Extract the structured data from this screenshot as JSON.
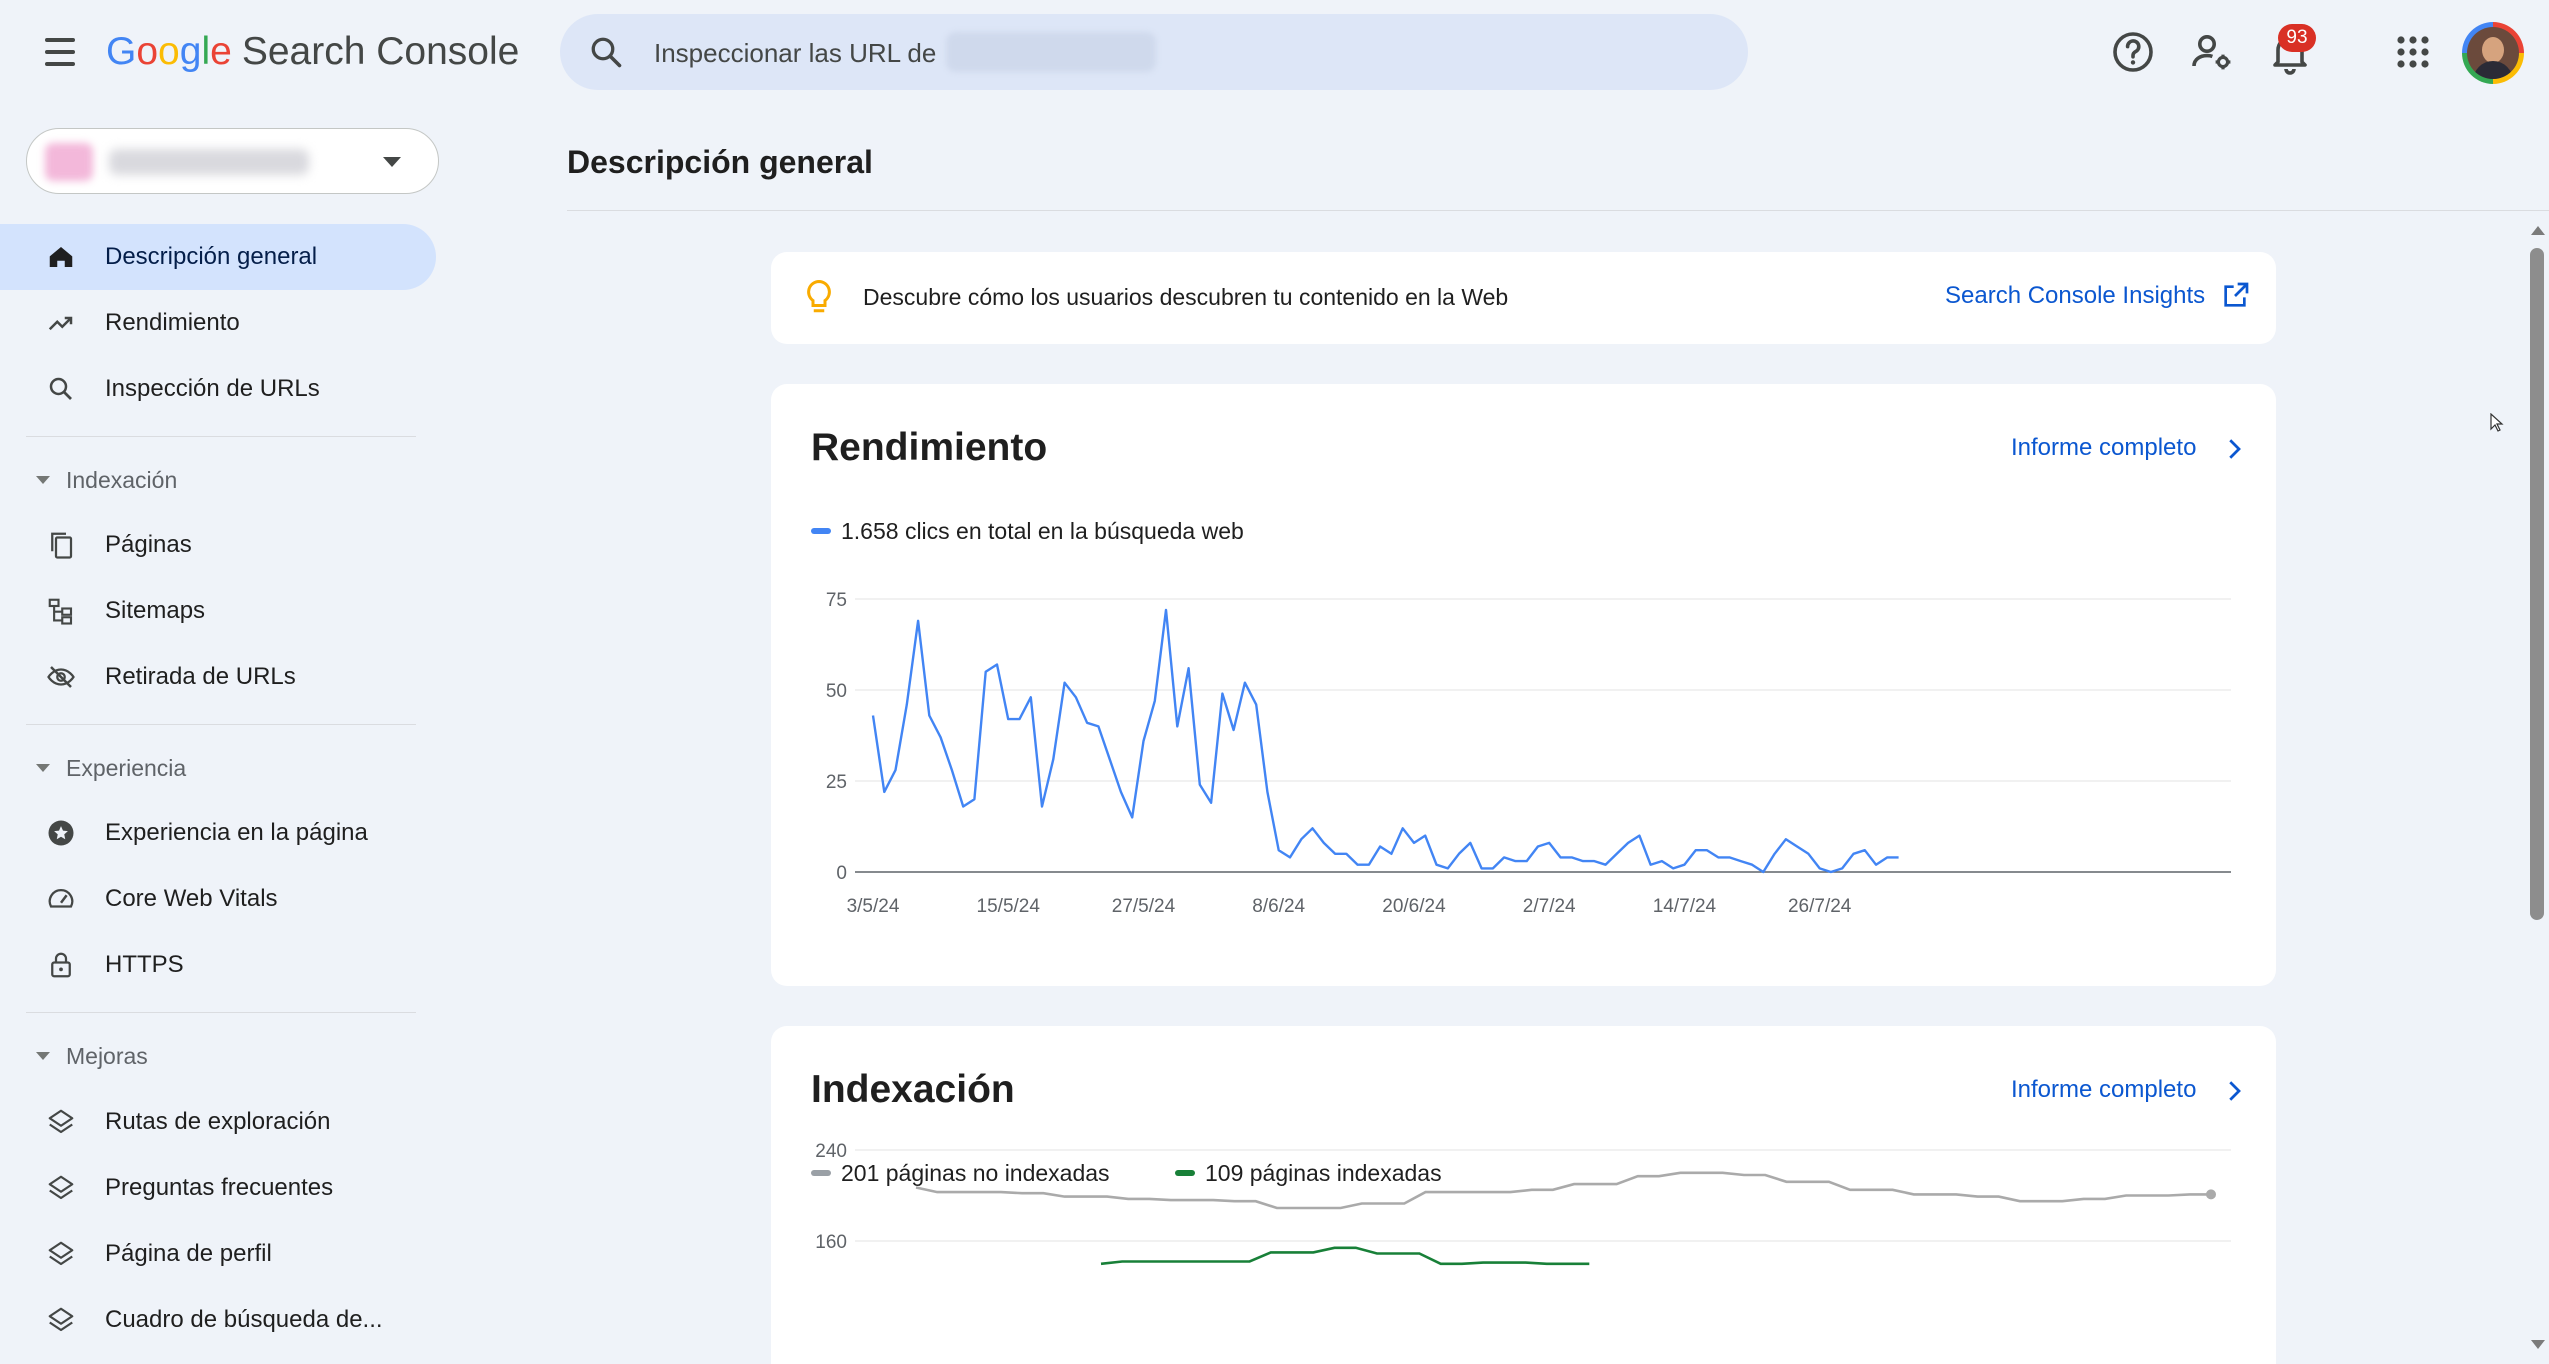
{
  "app": {
    "logo_google": [
      "G",
      "o",
      "o",
      "g",
      "l",
      "e"
    ],
    "product_name": "Search Console",
    "search_placeholder": "Inspeccionar las URL de",
    "notifications_count": "93",
    "colors": {
      "brand_blue": "#0b57d0",
      "active_nav": "#d3e3fd",
      "clicks_line": "#4285f4",
      "not_indexed_line": "#aaaaaa",
      "indexed_line": "#188038",
      "badge": "#d93025"
    }
  },
  "icons": {
    "menu": "hamburger-icon",
    "search": "search-icon",
    "help": "help-icon",
    "admin": "manage-accounts-icon",
    "notifications": "bell-icon",
    "apps": "apps-grid-icon"
  },
  "sidebar": {
    "items": [
      {
        "label": "Descripción general",
        "icon": "home-icon",
        "active": true
      },
      {
        "label": "Rendimiento",
        "icon": "trending-up-icon"
      },
      {
        "label": "Inspección de URLs",
        "icon": "search-icon"
      }
    ],
    "sections": [
      {
        "label": "Indexación",
        "items": [
          {
            "label": "Páginas",
            "icon": "pages-icon"
          },
          {
            "label": "Sitemaps",
            "icon": "sitemap-icon"
          },
          {
            "label": "Retirada de URLs",
            "icon": "eye-off-icon"
          }
        ]
      },
      {
        "label": "Experiencia",
        "items": [
          {
            "label": "Experiencia en la página",
            "icon": "star-badge-icon"
          },
          {
            "label": "Core Web Vitals",
            "icon": "speed-icon"
          },
          {
            "label": "HTTPS",
            "icon": "lock-icon"
          }
        ]
      },
      {
        "label": "Mejoras",
        "items": [
          {
            "label": "Rutas de exploración",
            "icon": "layers-icon"
          },
          {
            "label": "Preguntas frecuentes",
            "icon": "layers-icon"
          },
          {
            "label": "Página de perfil",
            "icon": "layers-icon"
          },
          {
            "label": "Cuadro de búsqueda de...",
            "icon": "layers-icon"
          }
        ]
      }
    ]
  },
  "main": {
    "page_title": "Descripción general",
    "banner": {
      "text": "Descubre cómo los usuarios descubren tu contenido en la Web",
      "link": "Search Console Insights"
    },
    "performance": {
      "title": "Rendimiento",
      "link": "Informe completo",
      "legend": "1.658 clics en total en la búsqueda web"
    },
    "indexing": {
      "title": "Indexación",
      "link": "Informe completo",
      "legend_not_indexed": "201 páginas no indexadas",
      "legend_indexed": "109 páginas indexadas"
    }
  },
  "chart_data": [
    {
      "type": "line",
      "title": "Rendimiento",
      "series": [
        {
          "name": "1.658 clics en total en la búsqueda web",
          "color": "#4285f4",
          "values": [
            43,
            22,
            28,
            46,
            69,
            43,
            37,
            28,
            18,
            20,
            55,
            57,
            42,
            42,
            48,
            18,
            31,
            52,
            48,
            41,
            40,
            31,
            22,
            15,
            36,
            47,
            72,
            40,
            56,
            24,
            19,
            49,
            39,
            52,
            46,
            22,
            6,
            4,
            9,
            12,
            8,
            5,
            5,
            2,
            2,
            7,
            5,
            12,
            8,
            10,
            2,
            1,
            5,
            8,
            1,
            1,
            4,
            3,
            3,
            7,
            8,
            4,
            4,
            3,
            3,
            2,
            5,
            8,
            10,
            2,
            3,
            1,
            2,
            6,
            6,
            4,
            4,
            3,
            2,
            0,
            5,
            9,
            7,
            5,
            1,
            0,
            1,
            5,
            6,
            2,
            4,
            4
          ]
        }
      ],
      "x_tick_labels": [
        "3/5/24",
        "15/5/24",
        "27/5/24",
        "8/6/24",
        "20/6/24",
        "2/7/24",
        "14/7/24",
        "26/7/24"
      ],
      "y_ticks": [
        0,
        25,
        50,
        75
      ],
      "ylim": [
        0,
        75
      ],
      "grid": true
    },
    {
      "type": "line",
      "title": "Indexación",
      "series": [
        {
          "name": "201 páginas no indexadas",
          "color": "#aaaaaa",
          "values": [
            207,
            203,
            203,
            203,
            203,
            202,
            202,
            199,
            199,
            199,
            197,
            197,
            196,
            196,
            196,
            195,
            195,
            189,
            189,
            189,
            189,
            193,
            193,
            193,
            203,
            203,
            203,
            203,
            203,
            205,
            205,
            210,
            210,
            210,
            217,
            217,
            220,
            220,
            220,
            218,
            218,
            212,
            212,
            212,
            205,
            205,
            205,
            201,
            201,
            201,
            199,
            199,
            195,
            195,
            195,
            197,
            197,
            200,
            200,
            200,
            201,
            201
          ]
        },
        {
          "name": "109 páginas indexadas",
          "color": "#188038",
          "values": [
            140,
            142,
            142,
            142,
            142,
            142,
            142,
            142,
            150,
            150,
            150,
            154,
            154,
            149,
            149,
            149,
            140,
            140,
            141,
            141,
            141,
            140,
            140,
            140
          ]
        }
      ],
      "y_ticks": [
        160,
        240
      ],
      "grid": true
    }
  ]
}
